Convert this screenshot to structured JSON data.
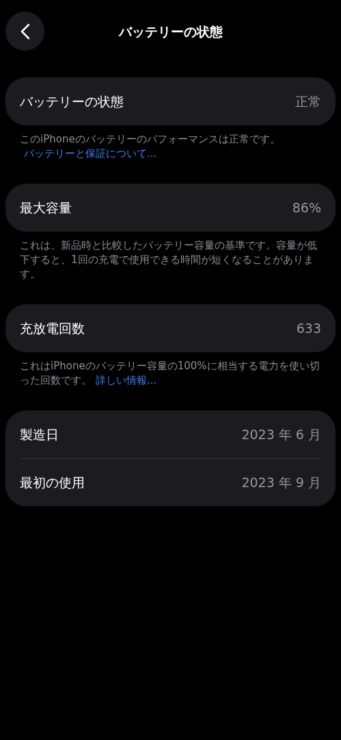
{
  "header": {
    "title": "バッテリーの状態"
  },
  "sections": [
    {
      "rows": [
        {
          "label": "バッテリーの状態",
          "value": "正常"
        }
      ],
      "footer": {
        "text": "このiPhoneのバッテリーのパフォーマンスは正常です。",
        "link": "バッテリーと保証について..."
      }
    },
    {
      "rows": [
        {
          "label": "最大容量",
          "value": "86%"
        }
      ],
      "footer": {
        "text": "これは、新品時と比較したバッテリー容量の基準です。容量が低下すると、1回の充電で使用できる時間が短くなることがあります。"
      }
    },
    {
      "rows": [
        {
          "label": "充放電回数",
          "value": "633"
        }
      ],
      "footer": {
        "text": "これはiPhoneのバッテリー容量の100%に相当する電力を使い切った回数です。",
        "link": "詳しい情報..."
      }
    },
    {
      "rows": [
        {
          "label": "製造日",
          "value": "2023 年 6 月"
        },
        {
          "label": "最初の使用",
          "value": "2023 年 9 月"
        }
      ]
    }
  ]
}
